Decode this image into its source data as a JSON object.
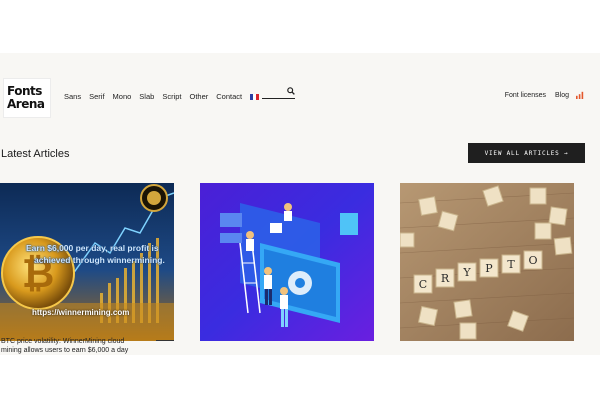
{
  "brand": {
    "line1": "Fonts",
    "line2": "Arena"
  },
  "nav": {
    "items": [
      "Sans",
      "Serif",
      "Mono",
      "Slab",
      "Script",
      "Other",
      "Contact"
    ],
    "flag_colors": [
      "#2a3fa3",
      "#ffffff",
      "#d8262c"
    ],
    "search_placeholder": ""
  },
  "right_links": {
    "licenses": "Font licenses",
    "blog": "Blog",
    "rss_icon": "rss-icon",
    "rss_color": "#e3572b"
  },
  "section": {
    "title": "Latest Articles",
    "view_all": "VIEW ALL ARTICLES →"
  },
  "articles": [
    {
      "overlay_line1": "Earn $6,000 per day, real profit is",
      "overlay_line2": "achieved through winnermining.",
      "domain": "https://winnermining.com",
      "caption_line1": "BTC price volatility: WinnerMining cloud",
      "caption_line2": "mining allows users to earn $6,000 a day"
    },
    {
      "image": "isometric-illustration"
    },
    {
      "image": "crypto-scrabble-tiles",
      "tile_word": [
        "C",
        "R",
        "Y",
        "P",
        "T",
        "O"
      ]
    }
  ],
  "colors": {
    "accent_dark": "#1f1f1f",
    "page_bg": "#f8f7f4"
  }
}
